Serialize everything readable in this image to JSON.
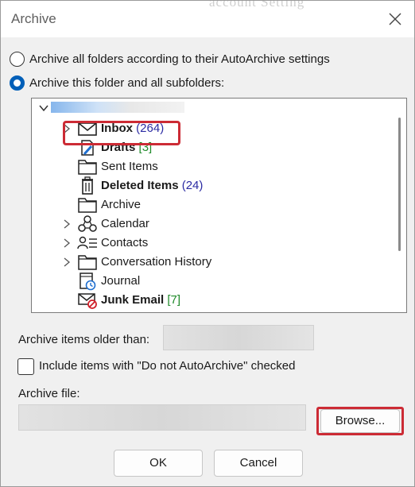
{
  "window": {
    "title": "Archive",
    "background_ghost_text": "account Setting"
  },
  "options": {
    "archive_all_label": "Archive all folders according to their AutoArchive settings",
    "archive_folder_label": "Archive this folder and all subfolders:"
  },
  "tree": {
    "items": [
      {
        "name": "Inbox",
        "count": "(264)",
        "count_style": "blue",
        "bold": true,
        "expandable": true,
        "icon": "envelope-icon"
      },
      {
        "name": "Drafts",
        "count": "[3]",
        "count_style": "green",
        "bold": true,
        "expandable": false,
        "icon": "draft-pencil-icon"
      },
      {
        "name": "Sent Items",
        "count": "",
        "count_style": "",
        "bold": false,
        "expandable": false,
        "icon": "folder-icon"
      },
      {
        "name": "Deleted Items",
        "count": "(24)",
        "count_style": "blue",
        "bold": true,
        "expandable": false,
        "icon": "trash-icon"
      },
      {
        "name": "Archive",
        "count": "",
        "count_style": "",
        "bold": false,
        "expandable": false,
        "icon": "folder-icon"
      },
      {
        "name": "Calendar",
        "count": "",
        "count_style": "",
        "bold": false,
        "expandable": true,
        "icon": "calendar-icon"
      },
      {
        "name": "Contacts",
        "count": "",
        "count_style": "",
        "bold": false,
        "expandable": true,
        "icon": "contacts-icon"
      },
      {
        "name": "Conversation History",
        "count": "",
        "count_style": "",
        "bold": false,
        "expandable": true,
        "icon": "folder-icon"
      },
      {
        "name": "Journal",
        "count": "",
        "count_style": "",
        "bold": false,
        "expandable": false,
        "icon": "journal-icon"
      },
      {
        "name": "Junk Email",
        "count": "[7]",
        "count_style": "green",
        "bold": true,
        "expandable": false,
        "icon": "junk-email-icon"
      }
    ]
  },
  "archive_older": {
    "label": "Archive items older than:"
  },
  "include": {
    "label": "Include items with \"Do not AutoArchive\" checked"
  },
  "archive_file": {
    "label": "Archive file:"
  },
  "buttons": {
    "browse": "Browse...",
    "ok": "OK",
    "cancel": "Cancel"
  },
  "colors": {
    "accent": "#005fb8",
    "highlight": "#cc2b35",
    "count_blue": "#2b2ba3",
    "count_green": "#1f8a2a"
  }
}
